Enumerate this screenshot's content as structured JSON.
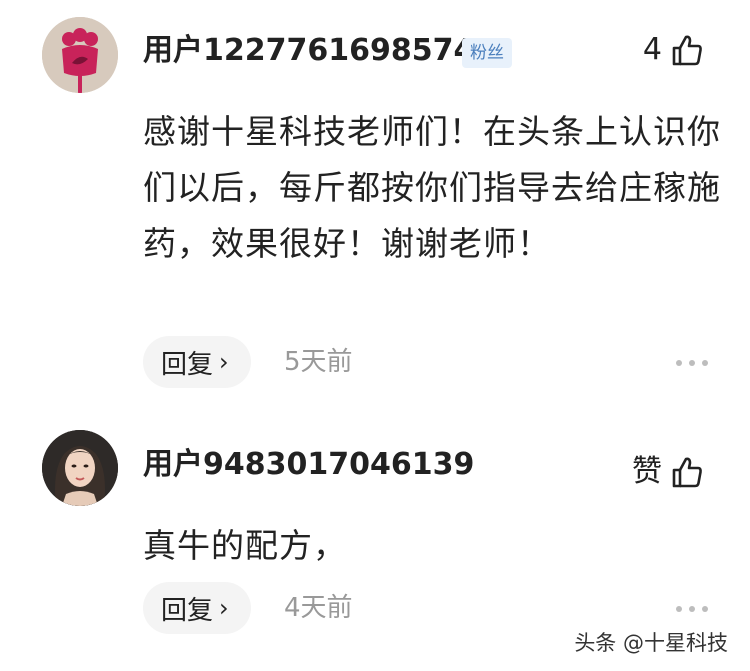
{
  "comments": [
    {
      "username": "用户1227761698574",
      "badge": "粉丝",
      "like_count": "4",
      "text": "感谢十星科技老师们！在头条上认识你们以后，每斤都按你们指导去给庄稼施药，效果很好！谢谢老师！",
      "reply_label": "回复",
      "time": "5天前",
      "avatar_icon": "red-flower-avatar"
    },
    {
      "username": "用户9483017046139",
      "like_label": "赞",
      "text": "真牛的配方，",
      "reply_label": "回复",
      "time": "4天前",
      "avatar_icon": "portrait-avatar"
    }
  ],
  "watermark": "头条 @十星科技",
  "colors": {
    "badge_bg": "#e8f1fb",
    "badge_text": "#4b7fbd",
    "muted": "#999999"
  }
}
